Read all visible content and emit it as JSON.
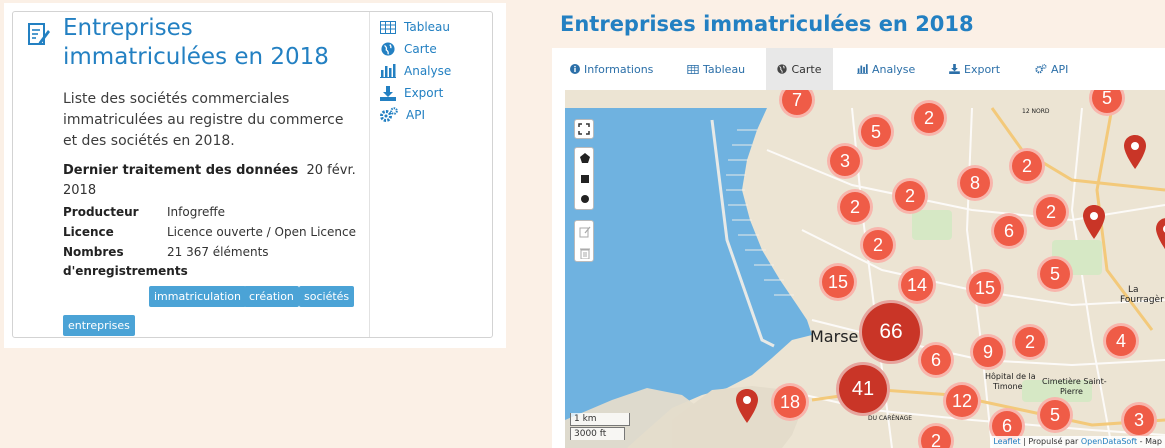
{
  "card": {
    "title": "Entreprises immatriculées en 2018",
    "description": "Liste des sociétés commerciales immatriculées au registre du commerce et des sociétés en 2018.",
    "last_processing_label": "Dernier traitement des données",
    "last_processing_value": "20 févr. 2018",
    "meta": [
      {
        "key": "Producteur",
        "value": "Infogreffe"
      },
      {
        "key": "Licence",
        "value": "Licence ouverte / Open Licence"
      },
      {
        "key": "Nombres",
        "value": "21 367 éléments"
      },
      {
        "key": "d'enregistrements",
        "value": ""
      }
    ],
    "tags": [
      "immatriculation",
      "création",
      "sociétés",
      "entreprises"
    ],
    "side_links": [
      {
        "label": "Tableau",
        "icon": "table-icon"
      },
      {
        "label": "Carte",
        "icon": "globe-icon"
      },
      {
        "label": "Analyse",
        "icon": "bar-chart-icon"
      },
      {
        "label": "Export",
        "icon": "download-icon"
      },
      {
        "label": "API",
        "icon": "cogs-icon"
      }
    ]
  },
  "page": {
    "title": "Entreprises immatriculées en 2018",
    "tabs": [
      {
        "label": "Informations",
        "icon": "info-icon"
      },
      {
        "label": "Tableau",
        "icon": "table-icon"
      },
      {
        "label": "Carte",
        "icon": "globe-icon",
        "active": true
      },
      {
        "label": "Analyse",
        "icon": "bar-chart-icon"
      },
      {
        "label": "Export",
        "icon": "download-icon"
      },
      {
        "label": "API",
        "icon": "cogs-icon"
      }
    ]
  },
  "map": {
    "clusters": [
      "7",
      "5",
      "2",
      "3",
      "2",
      "8",
      "2",
      "2",
      "2",
      "6",
      "2",
      "15",
      "14",
      "15",
      "5",
      "66",
      "6",
      "9",
      "2",
      "4",
      "41",
      "18",
      "12",
      "6",
      "5",
      "3",
      "2",
      "5"
    ],
    "labels": {
      "city": "Marse",
      "hospital_1": "Hôpital de la",
      "hospital_2": "Timone",
      "cemetery_1": "Cimetière Saint-",
      "cemetery_2": "Pierre",
      "la": "La",
      "fourragere": "Fourragèr",
      "road": "12 NORD",
      "carenage": "DU CARÉNAGE"
    },
    "scale_km": "1 km",
    "scale_ft": "3000 ft",
    "attribution_leaflet": "Leaflet",
    "attribution_text": " | Propulsé par ",
    "attribution_ods": "OpenDataSoft",
    "attribution_tail": " - Map"
  },
  "colors": {
    "accent": "#2380c2",
    "cluster": "#ef5c47",
    "cluster_dark": "#c93527",
    "sea": "#6fb2e0",
    "tag": "#4ba3d6"
  }
}
